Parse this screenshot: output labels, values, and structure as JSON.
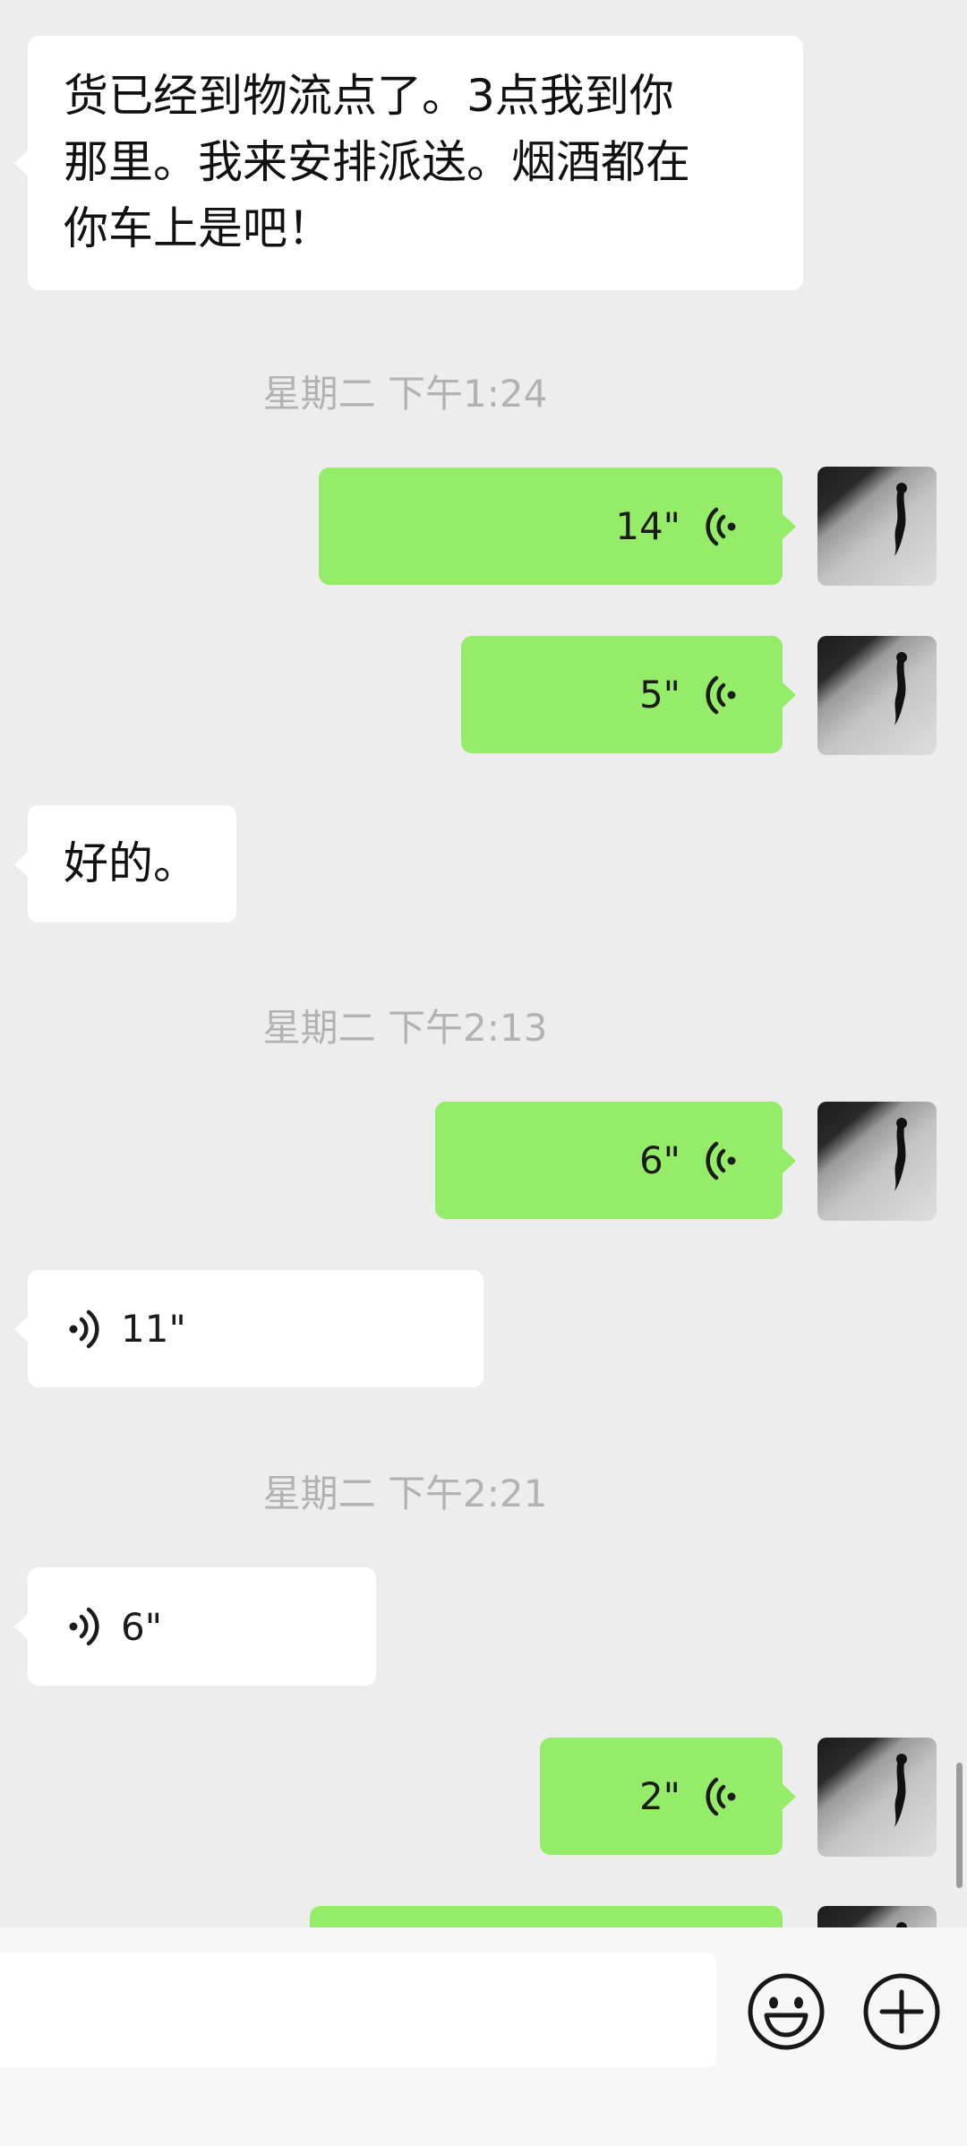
{
  "messages": {
    "m1_line1": "货已经到物流点了。3点我到你",
    "m1_line2": "那里。我来安排派送。烟酒都在",
    "m1_line3": "你车上是吧！",
    "t1": "星期二 下午1:24",
    "v1": "14\"",
    "v2": "5\"",
    "m2": "好的。",
    "t2": "星期二 下午2:13",
    "v3": "6\"",
    "v4": "11\"",
    "t3": "星期二 下午2:21",
    "v5": "6\"",
    "v6": "2\""
  },
  "colors": {
    "background": "#ededed",
    "incoming_bubble": "#ffffff",
    "outgoing_bubble": "#95ec69",
    "timestamp": "#b2b2b2"
  },
  "input_bar": {
    "icons": [
      "emoji-icon",
      "plus-icon"
    ]
  }
}
